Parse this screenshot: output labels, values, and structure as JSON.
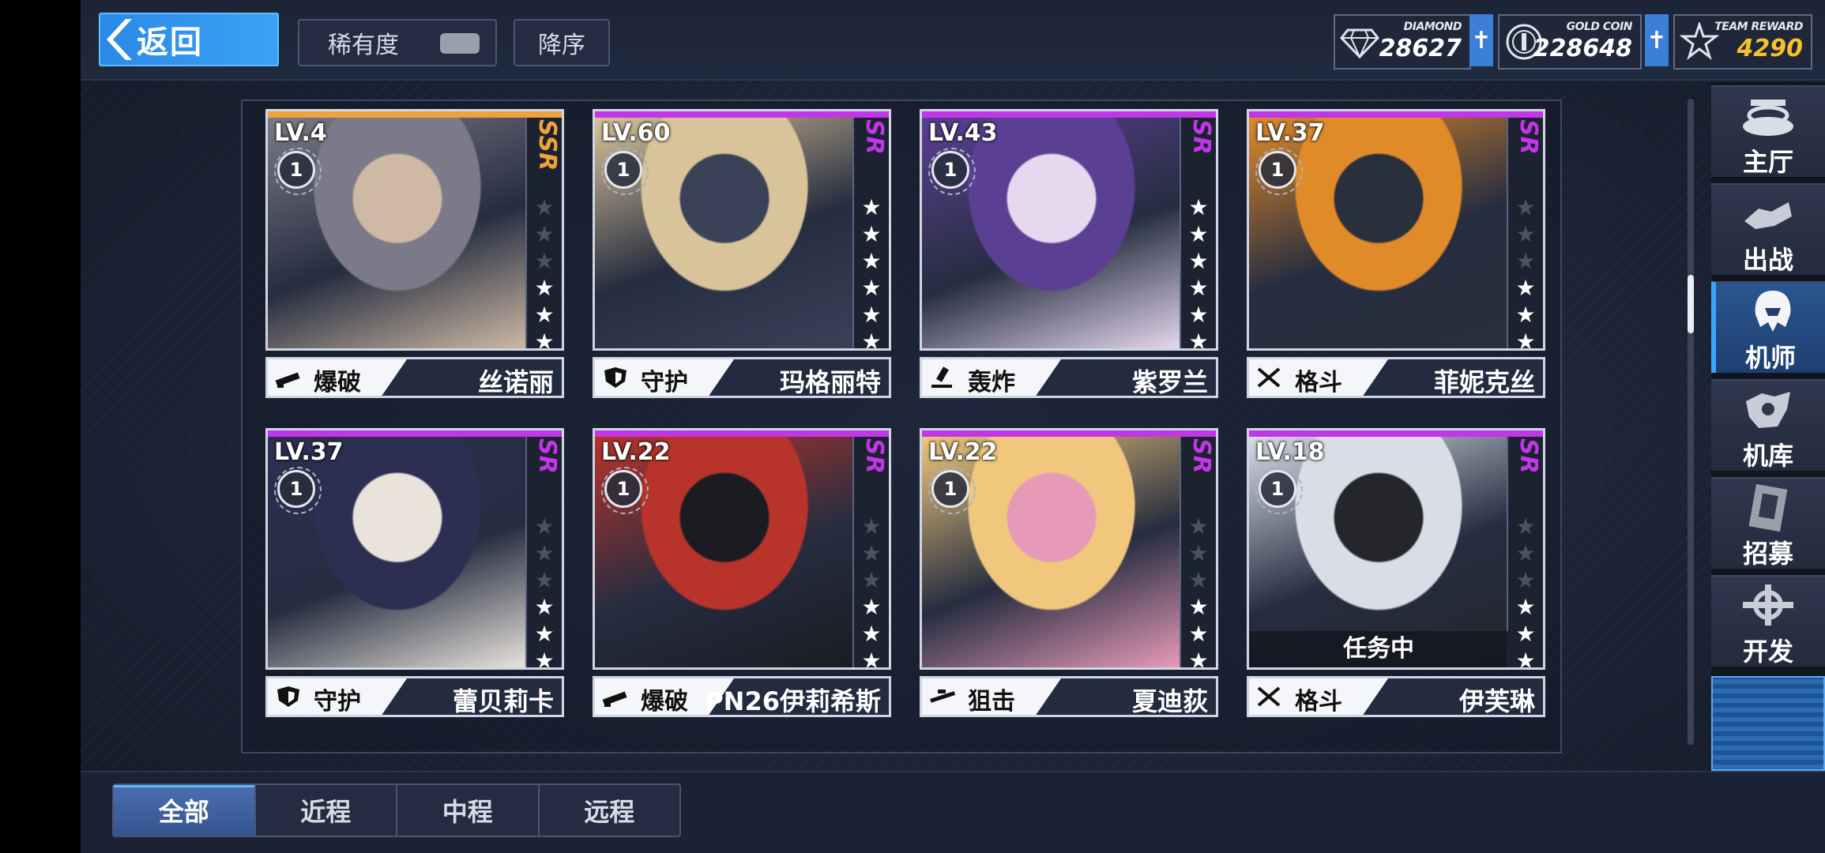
{
  "header": {
    "back_label": "返回",
    "rarity_filter_label": "稀有度",
    "sort_label": "降序"
  },
  "resources": [
    {
      "name": "DIAMOND",
      "value": "28627",
      "icon": "diamond-icon"
    },
    {
      "name": "GOLD COIN",
      "value": "228648",
      "icon": "gold-coin-icon"
    },
    {
      "name": "TEAM REWARD",
      "value": "4290",
      "icon": "team-reward-icon"
    }
  ],
  "plus_label": "✝",
  "pilots": [
    {
      "level": "LV.4",
      "rarity": "SSR",
      "rank": "1",
      "stars": 3,
      "class": "爆破",
      "name": "丝诺丽",
      "status": "",
      "art_colors": [
        "#7c7a88",
        "#cdb9a4"
      ]
    },
    {
      "level": "LV.60",
      "rarity": "SR",
      "rank": "1",
      "stars": 6,
      "class": "守护",
      "name": "玛格丽特",
      "status": "",
      "art_colors": [
        "#d9c39a",
        "#3a4258"
      ]
    },
    {
      "level": "LV.43",
      "rarity": "SR",
      "rank": "1",
      "stars": 6,
      "class": "轰炸",
      "name": "紫罗兰",
      "status": "",
      "art_colors": [
        "#5b3f93",
        "#e6d8ef"
      ]
    },
    {
      "level": "LV.37",
      "rarity": "SR",
      "rank": "1",
      "stars": 3,
      "class": "格斗",
      "name": "菲妮克丝",
      "status": "",
      "art_colors": [
        "#e08a2a",
        "#2a2f3c"
      ]
    },
    {
      "level": "LV.37",
      "rarity": "SR",
      "rank": "1",
      "stars": 3,
      "class": "守护",
      "name": "蕾贝莉卡",
      "status": "",
      "art_colors": [
        "#2d2f52",
        "#e9e3dc"
      ]
    },
    {
      "level": "LV.22",
      "rarity": "SR",
      "rank": "1",
      "stars": 3,
      "class": "爆破",
      "name": "PN26伊莉希斯",
      "status": "",
      "art_colors": [
        "#b8332a",
        "#1b1c22"
      ]
    },
    {
      "level": "LV.22",
      "rarity": "SR",
      "rank": "1",
      "stars": 3,
      "class": "狙击",
      "name": "夏迪荻",
      "status": "",
      "art_colors": [
        "#f0c77c",
        "#e79ab8"
      ]
    },
    {
      "level": "LV.18",
      "rarity": "SR",
      "rank": "1",
      "stars": 3,
      "class": "格斗",
      "name": "伊芙琳",
      "status": "任务中",
      "art_colors": [
        "#d8dde6",
        "#24262c"
      ]
    }
  ],
  "sidenav": [
    {
      "label": "主厅",
      "icon": "main-hall-icon",
      "active": false
    },
    {
      "label": "出战",
      "icon": "sortie-icon",
      "active": false
    },
    {
      "label": "机师",
      "icon": "pilot-icon",
      "active": true
    },
    {
      "label": "机库",
      "icon": "hangar-icon",
      "active": false
    },
    {
      "label": "招募",
      "icon": "recruit-icon",
      "active": false
    },
    {
      "label": "开发",
      "icon": "develop-icon",
      "active": false
    }
  ],
  "tabs": [
    {
      "label": "全部",
      "active": true
    },
    {
      "label": "近程",
      "active": false
    },
    {
      "label": "中程",
      "active": false
    },
    {
      "label": "远程",
      "active": false
    }
  ],
  "colors": {
    "ssr": "#f0a23a",
    "sr": "#c235e8",
    "accent_blue": "#3aa2f4",
    "gold": "#f6c327"
  }
}
